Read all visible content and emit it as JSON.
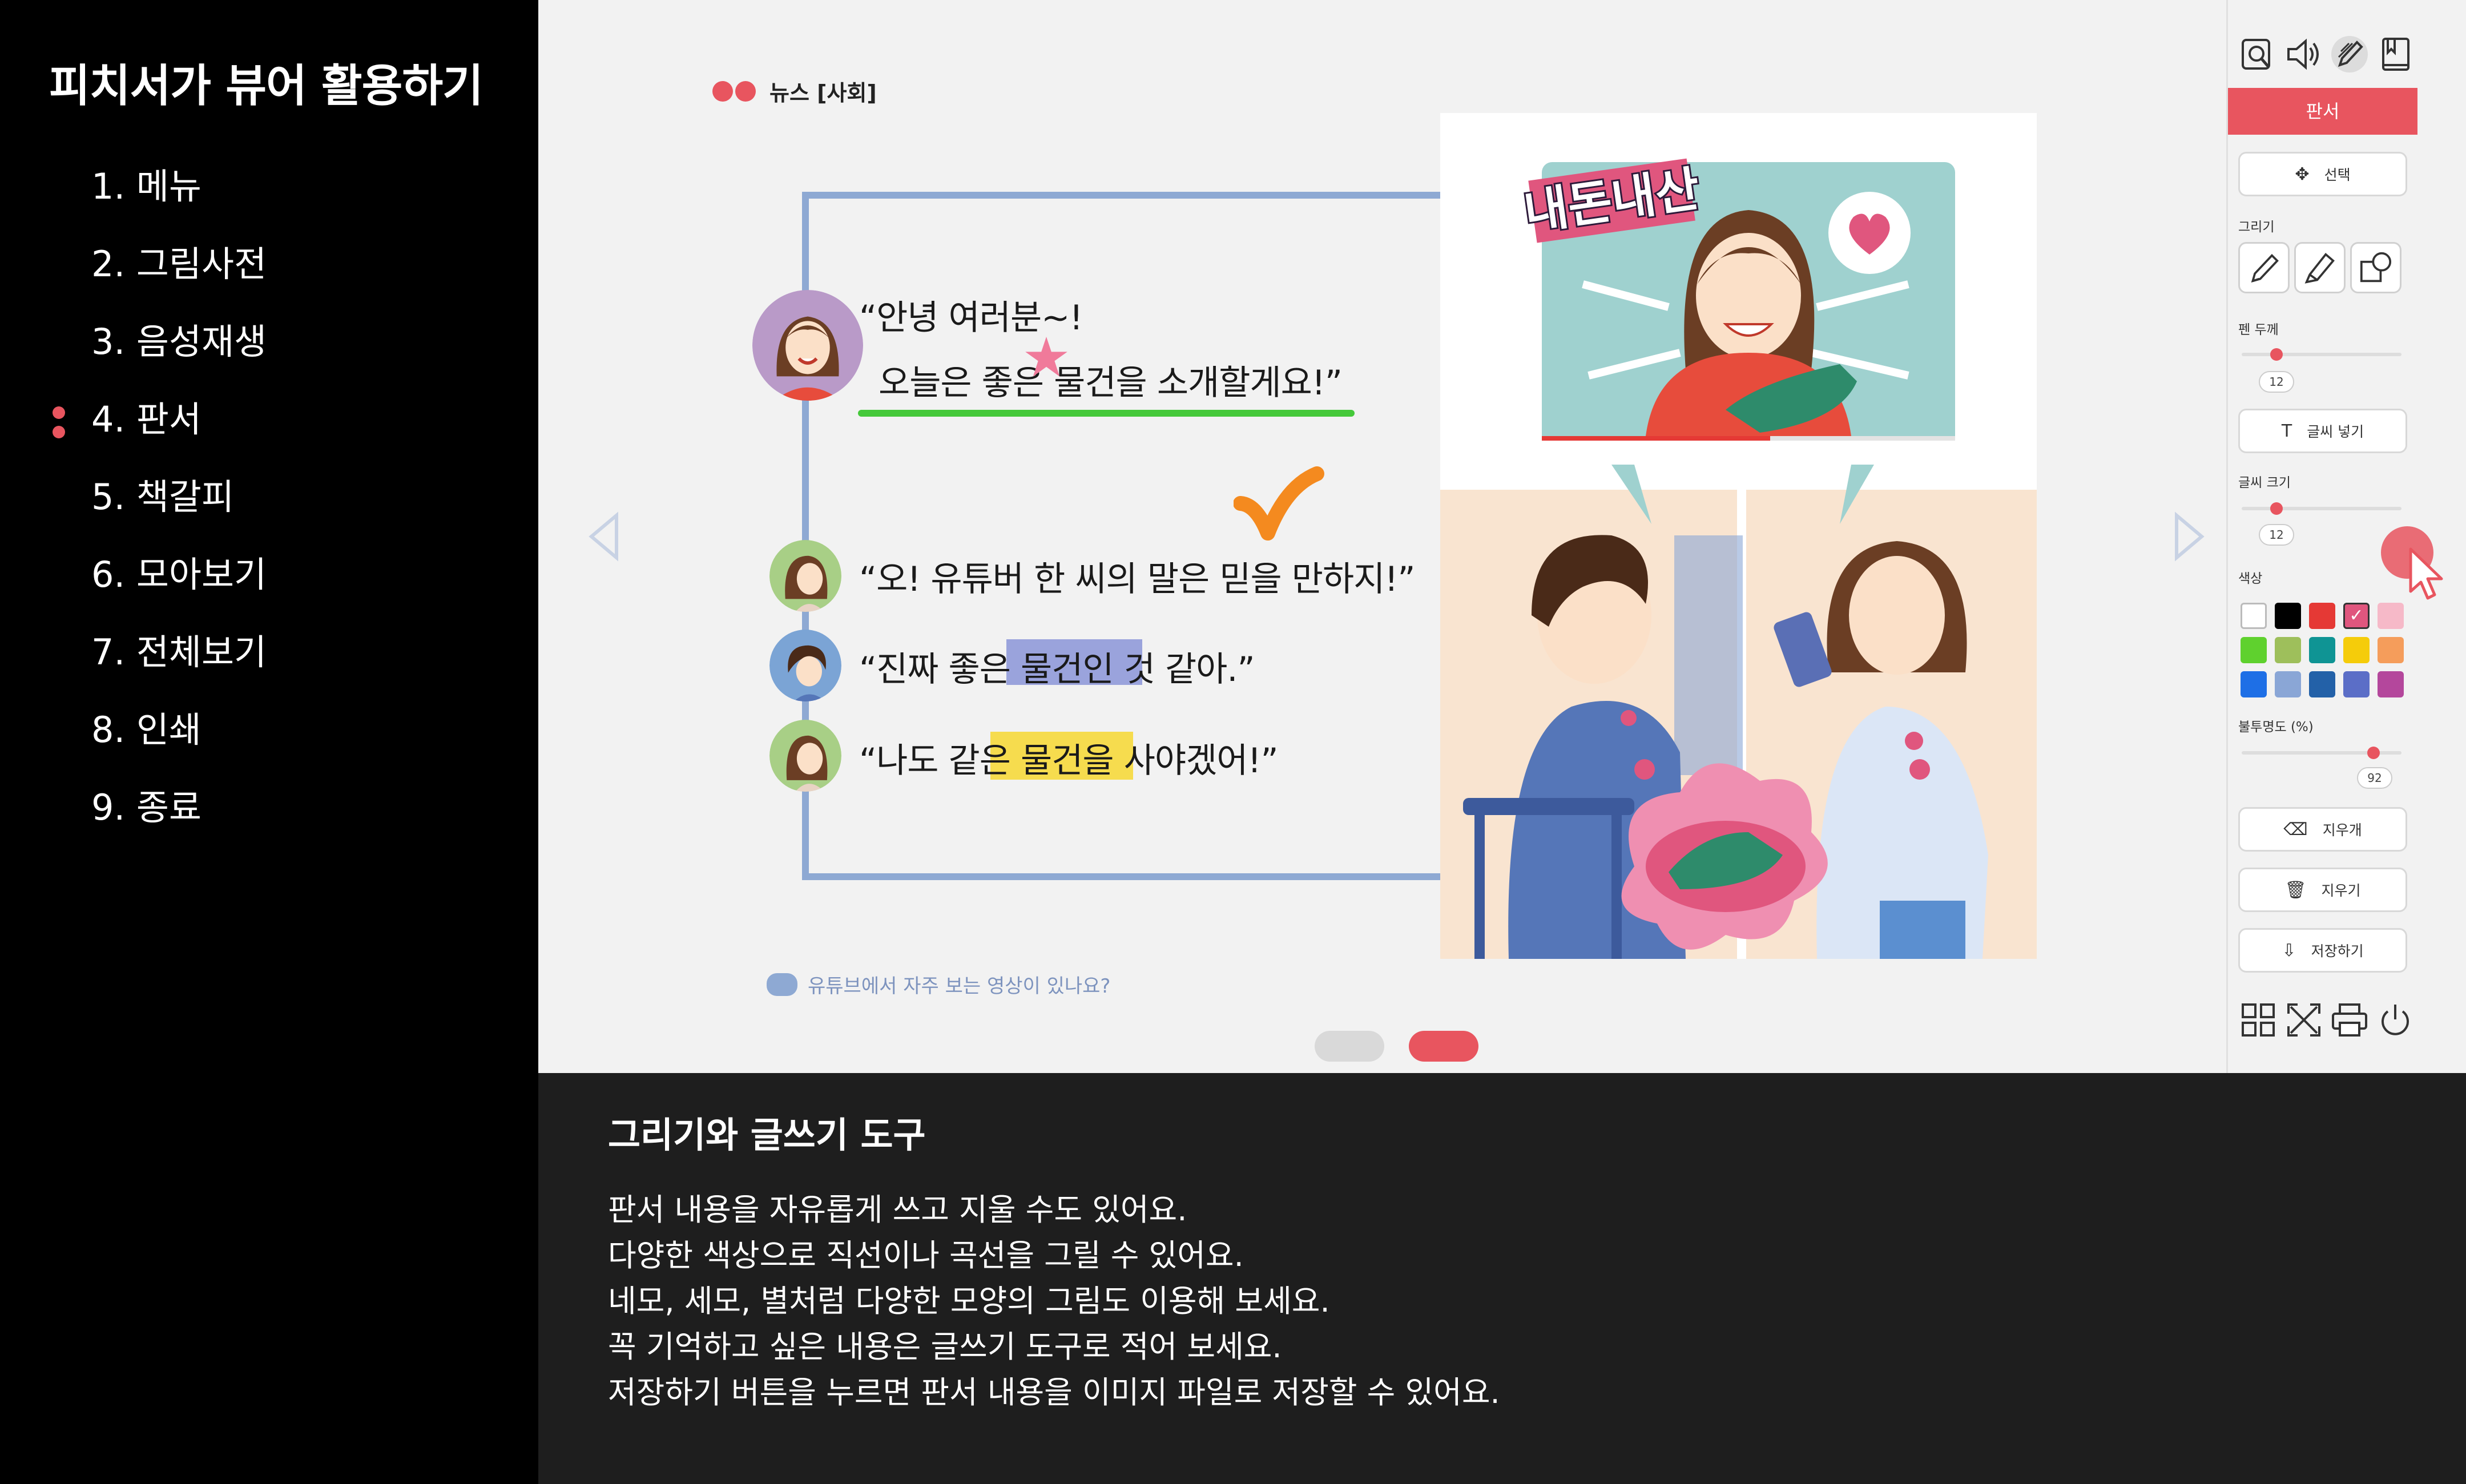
{
  "nav": {
    "title": "피치서가 뷰어 활용하기",
    "items": [
      {
        "label": "1. 메뉴"
      },
      {
        "label": "2. 그림사전"
      },
      {
        "label": "3. 음성재생"
      },
      {
        "label": "4. 판서",
        "active": true
      },
      {
        "label": "5. 책갈피"
      },
      {
        "label": "6. 모아보기"
      },
      {
        "label": "7. 전체보기"
      },
      {
        "label": "8. 인쇄"
      },
      {
        "label": "9. 종료"
      }
    ],
    "active_color": "#e8555f"
  },
  "page": {
    "news_tag": "뉴스 [사회]",
    "lines": {
      "l1a": "“안녕 여러분~!",
      "l1b": "오늘은 좋은 물건을 소개할게요!”",
      "l2": "“오! 유튜버 한 씨의 말은 믿을 만하지!”",
      "l3": "“진짜 좋은 물건인 것 같아.”",
      "l4": "“나도 같은 물건을 사야겠어!”"
    },
    "question": "유튜브에서 자주 보는 영상이 있나요?",
    "illustration_sign": "내돈내산",
    "annotation_colors": {
      "underline": "#45c93a",
      "star": "#f07a9a",
      "check": "#f48a1f",
      "highlight_purple": "#9aa3dc",
      "highlight_yellow": "#f6dc4e"
    },
    "pagination": {
      "total": 2,
      "current": 2
    }
  },
  "toolbar": {
    "top_icons": [
      "dictionary-search-icon",
      "speaker-icon",
      "pen-icon",
      "bookmark-icon"
    ],
    "header": "판서",
    "select_label": "선택",
    "draw_label": "그리기",
    "draw_tools": [
      "pencil-icon",
      "marker-icon",
      "shapes-icon"
    ],
    "pen_thickness_label": "펜 두께",
    "pen_thickness_value": "12",
    "text_insert_label": "글씨 넣기",
    "font_size_label": "글씨 크기",
    "font_size_value": "12",
    "color_label": "색상",
    "colors": [
      "#ffffff",
      "#000000",
      "#e53935",
      "#e0567e",
      "#f6b9c8",
      "#5fd12e",
      "#9ebf5b",
      "#0f9494",
      "#f5cc0a",
      "#f59d5b",
      "#1e6fe6",
      "#8aa6d6",
      "#2361a8",
      "#5b6ec7",
      "#b4479c"
    ],
    "selected_color_index": 3,
    "opacity_label": "불투명도 (%)",
    "opacity_value": "92",
    "eraser_label": "지우개",
    "clear_label": "지우기",
    "save_label": "저장하기",
    "bottom_icons": [
      "grid-icon",
      "fullscreen-icon",
      "print-icon",
      "power-icon"
    ]
  },
  "description": {
    "title": "그리기와 글쓰기 도구",
    "lines": [
      "판서 내용을 자유롭게 쓰고 지울 수도 있어요.",
      "다양한 색상으로 직선이나 곡선을 그릴 수 있어요.",
      "네모, 세모, 별처럼 다양한 모양의 그림도 이용해 보세요.",
      "꼭 기억하고 싶은 내용은 글쓰기 도구로 적어 보세요.",
      "저장하기 버튼을 누르면 판서 내용을 이미지 파일로 저장할 수 있어요."
    ]
  }
}
